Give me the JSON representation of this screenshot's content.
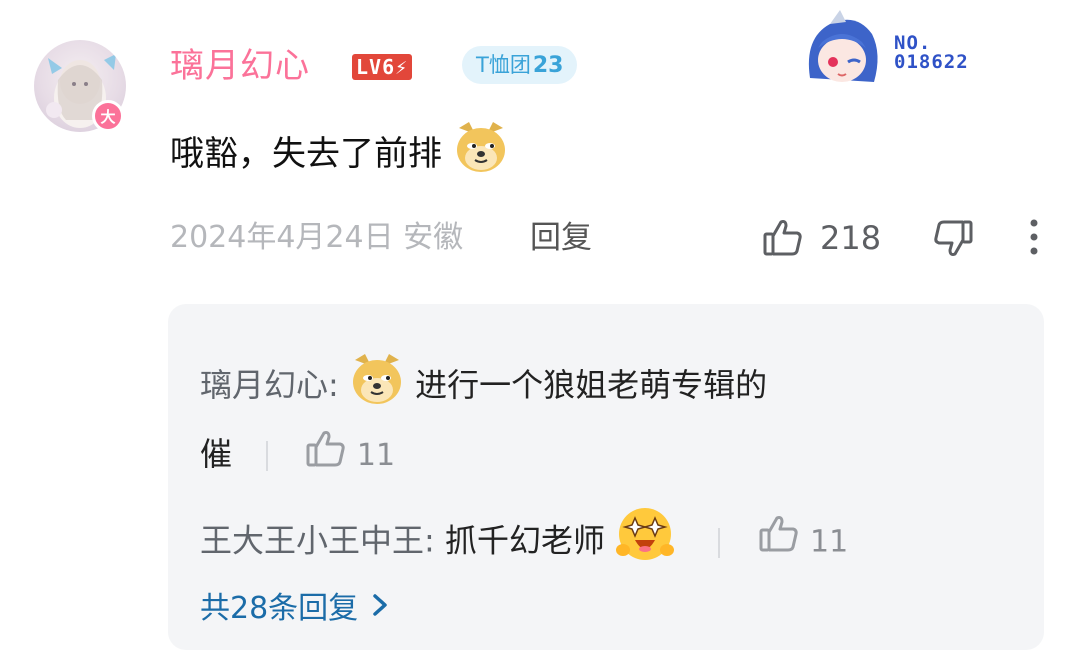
{
  "comment": {
    "username": "璃月幻心",
    "level": "LV6",
    "fan_badge_label": "T恤团",
    "fan_badge_level": "23",
    "avatar_badge": "大",
    "decoration_no_label": "NO.",
    "decoration_no_value": "018622",
    "text": "哦豁，失去了前排",
    "date": "2024年4月24日",
    "location": "安徽",
    "reply_label": "回复",
    "like_count": "218"
  },
  "replies": [
    {
      "user": "璃月幻心:",
      "text_line1": "进行一个狼姐老萌专辑的",
      "text_line2": "催",
      "like_count": "11"
    },
    {
      "user": "王大王小王中王:",
      "text": "抓千幻老师",
      "like_count": "11"
    }
  ],
  "more_replies_label": "共28条回复",
  "colors": {
    "username": "#fb7299",
    "level_bg": "#e2473a",
    "fan_badge_bg": "#e3f3fb",
    "fan_badge_text": "#3aa3d8",
    "link": "#1b6ca8"
  },
  "icons": [
    "thumbs-up-icon",
    "thumbs-down-icon",
    "more-vertical-icon",
    "doge-emoji",
    "excited-emoji",
    "chevron-right-icon"
  ]
}
